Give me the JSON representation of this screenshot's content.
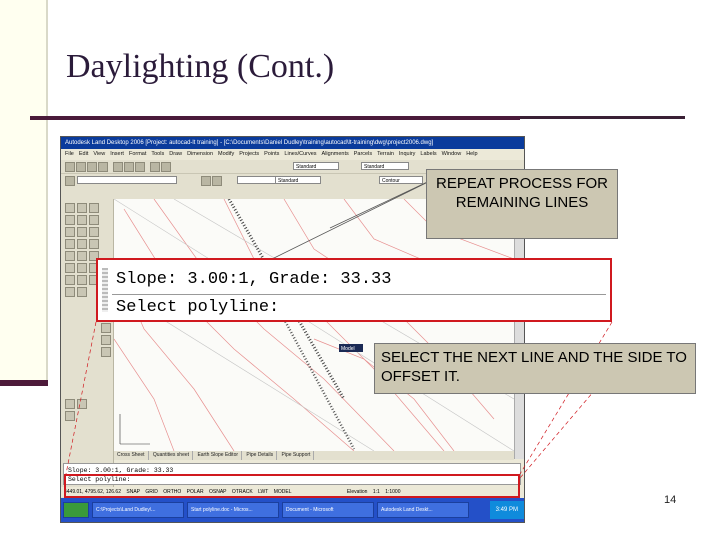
{
  "slide": {
    "title": "Daylighting (Cont.)",
    "slide_number": "14",
    "accent_color": "#4a1a3a"
  },
  "callouts": {
    "top": "REPEAT PROCESS FOR REMAINING LINES",
    "bottom": "SELECT THE NEXT LINE AND THE SIDE TO OFFSET IT."
  },
  "zoom": {
    "line1": "Slope: 3.00:1, Grade: 33.33",
    "line2": "Select polyline:"
  },
  "app": {
    "window_title": "Autodesk Land Desktop 2006 [Project: autocad-lt training] - [C:\\Documents\\Daniel Dudley\\training\\autocad\\lt-training\\dwg\\project2006.dwg]",
    "menu": [
      "File",
      "Edit",
      "View",
      "Insert",
      "Format",
      "Tools",
      "Draw",
      "Dimension",
      "Modify",
      "Projects",
      "Points",
      "Lines/Curves",
      "Alignments",
      "Parcels",
      "Terrain",
      "Inquiry",
      "Labels",
      "Window",
      "Help"
    ],
    "style_value": "Standard",
    "style_value2": "Standard",
    "layer_value": "Contour",
    "tabs": [
      "Cross Sheet",
      "Quantities sheet",
      "Earth Slope Editor",
      "Pipe Details",
      "Pipe Support"
    ],
    "command": {
      "line1": "Slope: 3.00:1, Grade: 33.33",
      "line2": "Select polyline:"
    },
    "status": {
      "coords": "4449.01, 4795.62, 126.62",
      "toggles": [
        "SNAP",
        "GRID",
        "ORTHO",
        "POLAR",
        "OSNAP",
        "OTRACK",
        "LWT",
        "MODEL"
      ],
      "elevation": "Elevation",
      "zoom_value": "1:1",
      "scale_value": "1:1000"
    },
    "model_label": "Model",
    "taskbar": [
      "C:\\Projects\\Land Dudley\\...",
      "Start polyline.doc - Micros...",
      "Document - Microsoft",
      "Autodesk Land Deskt..."
    ],
    "clock": "3:49 PM"
  }
}
